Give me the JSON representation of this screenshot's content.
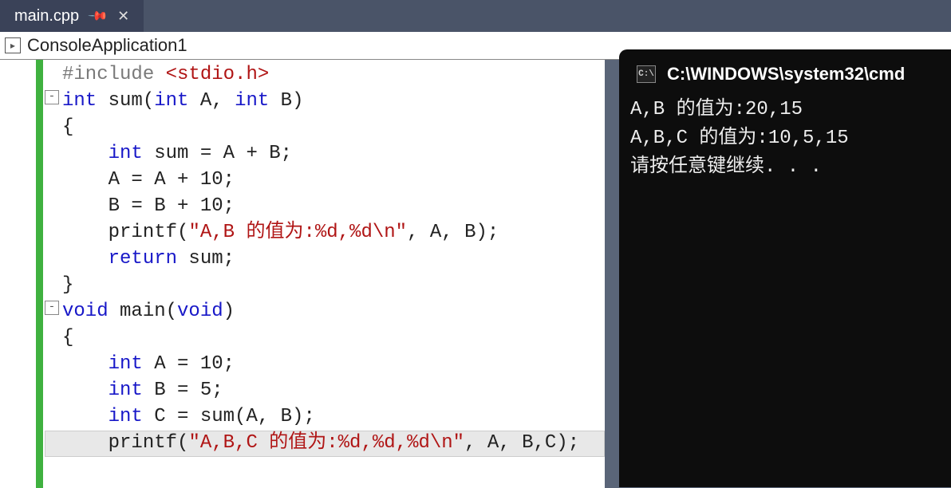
{
  "tab": {
    "filename": "main.cpp"
  },
  "project": {
    "title": "ConsoleApplication1"
  },
  "code": {
    "l1_pre": "#include ",
    "l1_inc": "<stdio.h>",
    "l2_kw1": "int",
    "l2_fn": " sum(",
    "l2_kw2": "int",
    "l2_pa": " A, ",
    "l2_kw3": "int",
    "l2_pb": " B)",
    "l3": "{",
    "l4_ind": "    ",
    "l4_kw": "int",
    "l4_rest": " sum = A + B;",
    "l5": "    A = A + 10;",
    "l6": "    B = B + 10;",
    "l7_ind": "    printf(",
    "l7_str": "\"A,B 的值为:%d,%d\\n\"",
    "l7_rest": ", A, B);",
    "l8_ind": "    ",
    "l8_kw": "return",
    "l8_rest": " sum;",
    "l9": "}",
    "l10_kw1": "void",
    "l10_fn": " main(",
    "l10_kw2": "void",
    "l10_rest": ")",
    "l11": "{",
    "l12_ind": "    ",
    "l12_kw": "int",
    "l12_rest": " A = 10;",
    "l13_ind": "    ",
    "l13_kw": "int",
    "l13_rest": " B = 5;",
    "l14_ind": "    ",
    "l14_kw": "int",
    "l14_rest": " C = sum(A, B);",
    "l15_ind": "    printf(",
    "l15_str": "\"A,B,C 的值为:%d,%d,%d\\n\"",
    "l15_rest": ", A, B,C);"
  },
  "terminal": {
    "title": "C:\\WINDOWS\\system32\\cmd",
    "line1": "A,B 的值为:20,15",
    "line2": "A,B,C 的值为:10,5,15",
    "line3": "请按任意键继续. . ."
  }
}
